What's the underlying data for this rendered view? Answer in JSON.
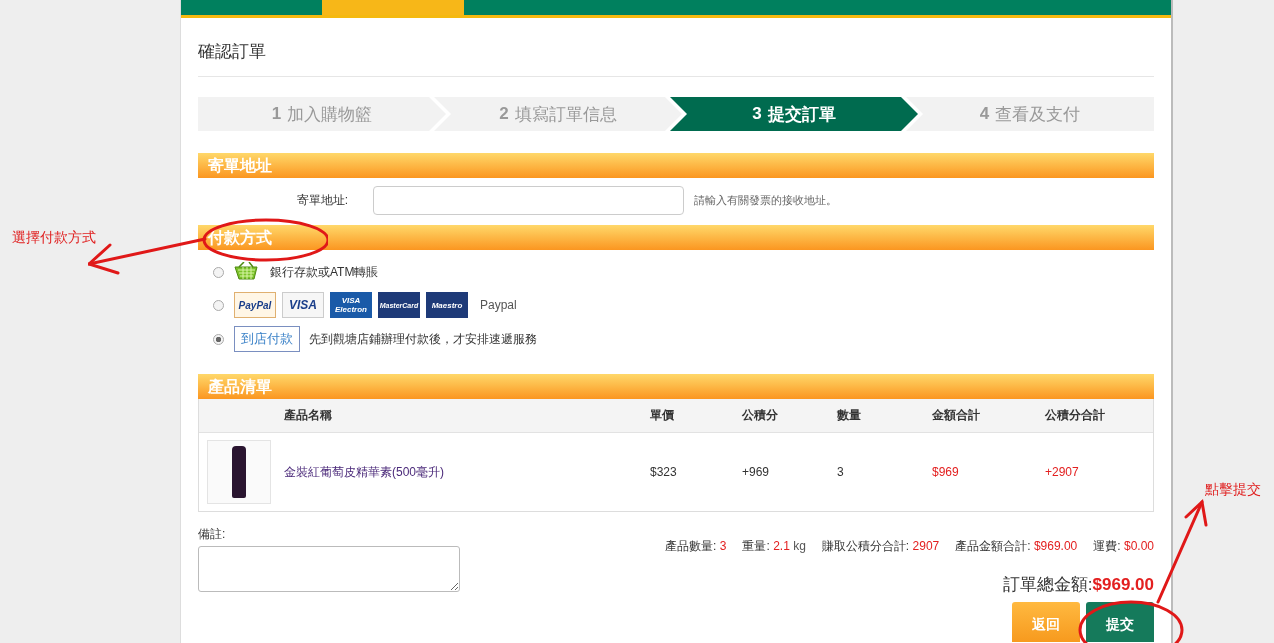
{
  "nav": {
    "items": [
      {
        "selected": false
      },
      {
        "selected": true
      },
      {
        "selected": false
      },
      {
        "selected": false
      },
      {
        "selected": false
      },
      {
        "selected": false
      },
      {
        "selected": false
      }
    ]
  },
  "page_title": "確認訂單",
  "steps": [
    {
      "number": "1",
      "label": "加入購物籃",
      "selected": false
    },
    {
      "number": "2",
      "label": "填寫訂單信息",
      "selected": false
    },
    {
      "number": "3",
      "label": "提交訂單",
      "selected": true
    },
    {
      "number": "4",
      "label": "查看及支付",
      "selected": false
    }
  ],
  "address_section": {
    "title": "寄單地址",
    "label": "寄單地址:",
    "hint": "請輸入有關發票的接收地址。"
  },
  "payment_section": {
    "title": "付款方式",
    "options": [
      {
        "kind": "bank",
        "label": "銀行存款或ATM轉賬",
        "selected": false
      },
      {
        "kind": "cards",
        "logos": [
          "PayPal",
          "VISA",
          "VISA Electron",
          "MasterCard",
          "Maestro"
        ],
        "label": "Paypal",
        "selected": false
      },
      {
        "kind": "store",
        "badge": "到店付款",
        "label": "先到觀塘店鋪辦理付款後，才安排速遞服務",
        "selected": true
      }
    ]
  },
  "products_section": {
    "title": "產品清單",
    "columns": [
      {
        "label": "產品名稱",
        "kind": "link"
      },
      {
        "label": "單價",
        "kind": "plain"
      },
      {
        "label": "公積分",
        "kind": "plain"
      },
      {
        "label": "數量",
        "kind": "plain"
      },
      {
        "label": "金額合計",
        "kind": "highlight"
      },
      {
        "label": "公積分合計",
        "kind": "highlight"
      }
    ],
    "rows": [
      {
        "cells": [
          "金裝紅葡萄皮精華素(500毫升)",
          "$323",
          "+969",
          "3",
          "$969",
          "+2907"
        ]
      }
    ]
  },
  "remarks": {
    "label": "備註:"
  },
  "summary": [
    {
      "label": "產品數量:",
      "value": "3"
    },
    {
      "label": "重量:",
      "value": "2.1",
      "unit": "kg"
    },
    {
      "label": "賺取公積分合計:",
      "value": "2907"
    },
    {
      "label": "產品金額合計:",
      "value": "$969.00"
    },
    {
      "label": "運費:",
      "value": "$0.00"
    }
  ],
  "total": {
    "label": "訂單總金額:",
    "value": "$969.00"
  },
  "buttons": [
    {
      "label": "返回",
      "kind": "secondary"
    },
    {
      "label": "提交",
      "kind": "primary"
    }
  ],
  "annotations": [
    {
      "text": "選擇付款方式",
      "kind": "left"
    },
    {
      "text": "點擊提交",
      "kind": "right"
    }
  ]
}
